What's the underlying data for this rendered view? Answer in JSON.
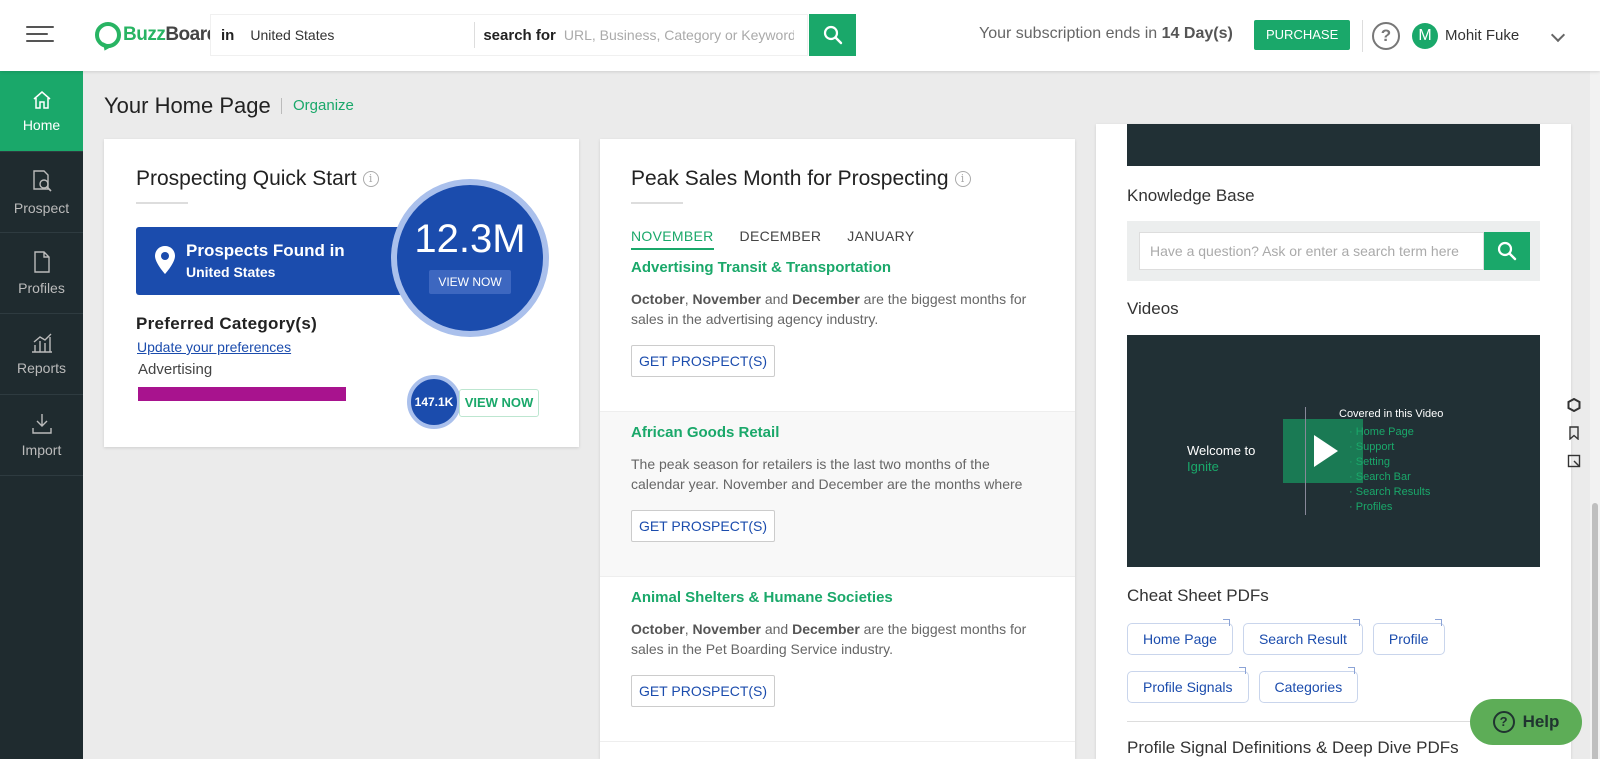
{
  "brand": {
    "name_part1": "Buzz",
    "name_part2": "Board"
  },
  "search": {
    "in_label": "in",
    "location": "United States",
    "for_label": "search for",
    "placeholder": "URL, Business, Category or Keyword"
  },
  "subscription": {
    "prefix": "Your subscription ends in",
    "days": "14 Day(s)",
    "purchase_label": "PURCHASE"
  },
  "user": {
    "initial": "M",
    "name": "Mohit Fuke"
  },
  "help_icon_label": "?",
  "sidebar": {
    "items": [
      {
        "label": "Home",
        "icon": "home-icon"
      },
      {
        "label": "Prospect",
        "icon": "prospect-search-icon"
      },
      {
        "label": "Profiles",
        "icon": "document-icon"
      },
      {
        "label": "Reports",
        "icon": "bar-chart-icon"
      },
      {
        "label": "Import",
        "icon": "upload-tray-icon"
      }
    ]
  },
  "page": {
    "title": "Your Home Page",
    "organize": "Organize"
  },
  "quick_start": {
    "title": "Prospecting Quick Start",
    "prospects_line1": "Prospects Found in",
    "prospects_line2": "United States",
    "total": "12.3M",
    "view_now": "VIEW NOW",
    "preferred_title": "Preferred Category(s)",
    "update_link": "Update your preferences",
    "category": "Advertising",
    "category_count": "147.1K",
    "category_view": "VIEW NOW"
  },
  "peak": {
    "title": "Peak Sales Month for Prospecting",
    "tabs": [
      "NOVEMBER",
      "DECEMBER",
      "JANUARY"
    ],
    "items": [
      {
        "name": "Advertising Transit & Transportation",
        "m1": "October",
        "sep1": ", ",
        "m2": "November",
        "and": " and ",
        "m3": "December",
        "rest": " are the biggest months for sales in the advertising agency industry.",
        "button": "GET PROSPECT(S)"
      },
      {
        "name": "African Goods Retail",
        "desc": "The peak season for retailers is the last two months of the calendar year. November and December are the months where",
        "button": "GET PROSPECT(S)"
      },
      {
        "name": "Animal Shelters & Humane Societies",
        "m1": "October",
        "sep1": ", ",
        "m2": "November",
        "and": " and ",
        "m3": "December",
        "rest": " are the biggest months for sales in the Pet Boarding Service industry.",
        "button": "GET PROSPECT(S)"
      }
    ]
  },
  "right": {
    "kb_title": "Knowledge Base",
    "kb_placeholder": "Have a question? Ask or enter a search term here",
    "videos_title": "Videos",
    "video": {
      "welcome": "Welcome to",
      "product": "Ignite",
      "covered": "Covered in this Video",
      "topics": [
        "Home Page",
        "Support",
        "Setting",
        "Search Bar",
        "Search Results",
        "Profiles"
      ]
    },
    "cheat_title": "Cheat Sheet PDFs",
    "cheat_row1": [
      "Home Page",
      "Search Result",
      "Profile"
    ],
    "cheat_row2": [
      "Profile Signals",
      "Categories"
    ],
    "deep_title": "Profile Signal Definitions & Deep Dive PDFs"
  },
  "help_widget": {
    "label": "Help"
  },
  "colors": {
    "green": "#1aa86a",
    "blue": "#1b4cad",
    "sidebar": "#1f2b2f",
    "magenta": "#a8138e"
  }
}
